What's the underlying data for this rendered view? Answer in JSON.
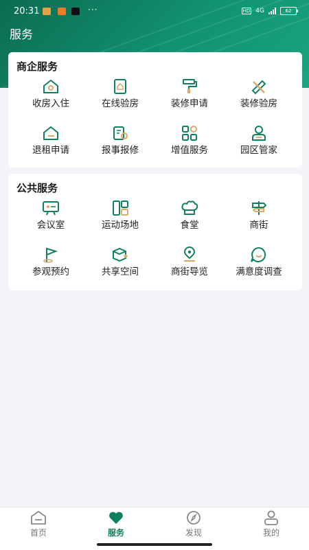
{
  "status_bar": {
    "time": "20:31",
    "dots": "···",
    "network": "4G",
    "battery": "62"
  },
  "header": {
    "title": "服务"
  },
  "business_services": {
    "title": "商企服务",
    "items": [
      {
        "label": "收房入住",
        "icon": "house-key-icon"
      },
      {
        "label": "在线验房",
        "icon": "house-check-icon"
      },
      {
        "label": "装修申请",
        "icon": "paint-roller-icon"
      },
      {
        "label": "装修验房",
        "icon": "ruler-pencil-icon"
      },
      {
        "label": "退租申请",
        "icon": "house-exit-icon"
      },
      {
        "label": "报事报修",
        "icon": "wrench-icon"
      },
      {
        "label": "增值服务",
        "icon": "grid-apps-icon"
      },
      {
        "label": "园区管家",
        "icon": "person-icon"
      }
    ]
  },
  "public_services": {
    "title": "公共服务",
    "items": [
      {
        "label": "会议室",
        "icon": "meeting-board-icon"
      },
      {
        "label": "运动场地",
        "icon": "court-icon"
      },
      {
        "label": "食堂",
        "icon": "chef-hat-icon"
      },
      {
        "label": "商街",
        "icon": "signpost-icon"
      },
      {
        "label": "参观预约",
        "icon": "flag-icon"
      },
      {
        "label": "共享空间",
        "icon": "share-box-icon"
      },
      {
        "label": "商街导览",
        "icon": "map-pin-icon"
      },
      {
        "label": "满意度调查",
        "icon": "smile-chat-icon"
      }
    ]
  },
  "bottom_nav": {
    "items": [
      {
        "label": "首页",
        "icon": "home-icon",
        "active": false
      },
      {
        "label": "服务",
        "icon": "heart-icon",
        "active": true
      },
      {
        "label": "发现",
        "icon": "compass-icon",
        "active": false
      },
      {
        "label": "我的",
        "icon": "profile-icon",
        "active": false
      }
    ]
  },
  "colors": {
    "primary": "#0f7f5f",
    "accent": "#d9a96a",
    "background": "#f3f4f8"
  }
}
